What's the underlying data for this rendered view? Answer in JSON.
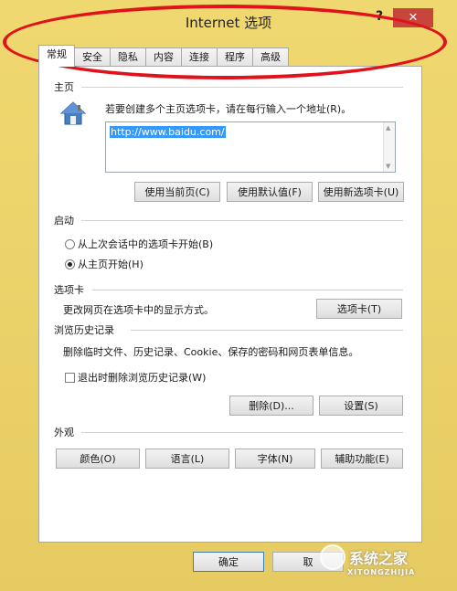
{
  "window": {
    "title": "Internet 选项",
    "help_label": "?",
    "close_label": "✕"
  },
  "tabs": [
    {
      "label": "常规",
      "active": true
    },
    {
      "label": "安全",
      "active": false
    },
    {
      "label": "隐私",
      "active": false
    },
    {
      "label": "内容",
      "active": false
    },
    {
      "label": "连接",
      "active": false
    },
    {
      "label": "程序",
      "active": false
    },
    {
      "label": "高级",
      "active": false
    }
  ],
  "homepage": {
    "section_title": "主页",
    "description": "若要创建多个主页选项卡，请在每行输入一个地址(R)。",
    "url": "http://www.baidu.com/",
    "icon": "house-icon",
    "use_current": "使用当前页(C)",
    "use_default": "使用默认值(F)",
    "use_new_tab": "使用新选项卡(U)"
  },
  "startup": {
    "section_title": "启动",
    "option_last_session": "从上次会话中的选项卡开始(B)",
    "option_homepage": "从主页开始(H)",
    "selected": "option_homepage"
  },
  "tabs_section": {
    "section_title": "选项卡",
    "description": "更改网页在选项卡中的显示方式。",
    "button": "选项卡(T)"
  },
  "history": {
    "section_title": "浏览历史记录",
    "description": "删除临时文件、历史记录、Cookie、保存的密码和网页表单信息。",
    "checkbox_label": "退出时删除浏览历史记录(W)",
    "checked": false,
    "delete_button": "删除(D)...",
    "settings_button": "设置(S)"
  },
  "appearance": {
    "section_title": "外观",
    "colors": "颜色(O)",
    "languages": "语言(L)",
    "fonts": "字体(N)",
    "accessibility": "辅助功能(E)"
  },
  "footer": {
    "ok": "确定",
    "cancel": "取"
  },
  "watermark": {
    "text": "系统之家",
    "sub": "XITONGZHIJIA"
  },
  "colors": {
    "frame": "#e9d16e",
    "close": "#c7453a",
    "annotation": "#e0121c",
    "selection": "#3399ff"
  }
}
